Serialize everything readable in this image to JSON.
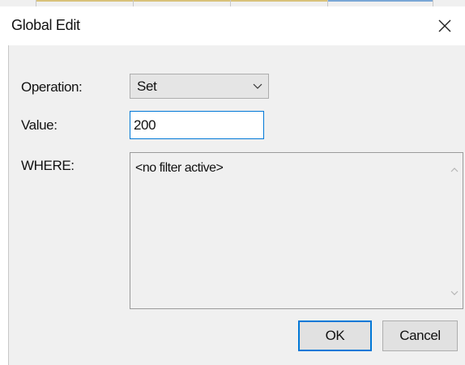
{
  "window": {
    "title": "Global Edit",
    "close_icon": "close-x-icon"
  },
  "form": {
    "operation_label": "Operation:",
    "operation_value": "Set",
    "value_label": "Value:",
    "value_input": "200",
    "where_label": "WHERE:",
    "where_text": "<no filter active>"
  },
  "buttons": {
    "ok": "OK",
    "cancel": "Cancel"
  },
  "colors": {
    "focus_accent": "#0078d7",
    "client_background": "#f0f0f0"
  }
}
